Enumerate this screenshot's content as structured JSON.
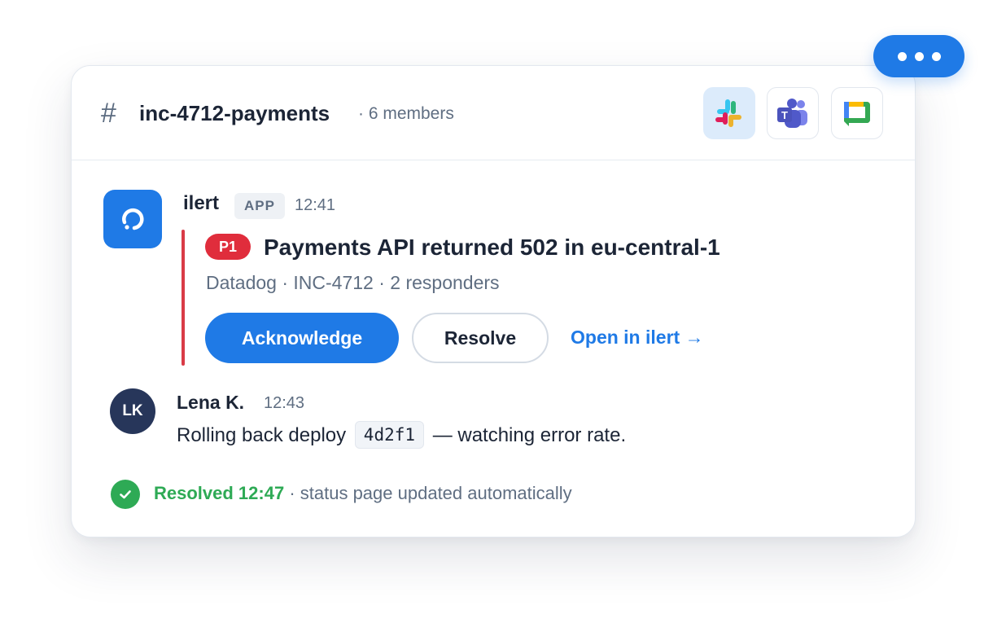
{
  "channel": {
    "hash": "#",
    "name": "inc-4712-payments",
    "members": "· 6 members"
  },
  "integrations": [
    {
      "name": "slack-icon",
      "active": true
    },
    {
      "name": "microsoft-teams-icon",
      "active": false
    },
    {
      "name": "google-chat-icon",
      "active": false
    }
  ],
  "more_button": {
    "icon": "more-horizontal-icon"
  },
  "ilert_message": {
    "sender": "ilert",
    "badge": "APP",
    "time": "12:41",
    "alert": {
      "priority": "P1",
      "title": "Payments API returned 502 in eu-central-1",
      "meta": "Datadog · INC-4712 · 2 responders",
      "accent_color": "#d93b47"
    },
    "actions": {
      "acknowledge": "Acknowledge",
      "resolve": "Resolve",
      "open_link": "Open in ilert →"
    }
  },
  "user_message": {
    "avatar_initials": "LK",
    "name": "Lena K.",
    "time": "12:43",
    "text_before": "Rolling back deploy",
    "code": "4d2f1",
    "text_after": "— watching error rate."
  },
  "status": {
    "icon": "check-circle-icon",
    "resolved": "Resolved 12:47",
    "detail": "· status page updated automatically"
  },
  "colors": {
    "accent": "#1f7ae6",
    "danger": "#e02d3c",
    "success": "#2eaa55",
    "text": "#1c2536",
    "muted": "#5f6e82"
  }
}
